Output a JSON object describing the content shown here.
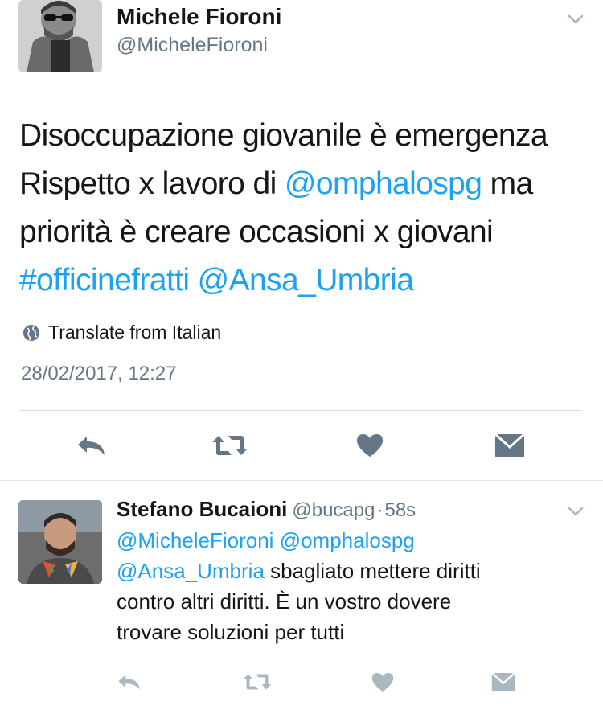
{
  "main_tweet": {
    "author": {
      "name": "Michele Fioroni",
      "handle": "@MicheleFioroni"
    },
    "text_lines": [
      [
        {
          "text": "Disoccupazione giovanile è emergenza",
          "type": "plain"
        }
      ],
      [
        {
          "text": "Rispetto x lavoro di ",
          "type": "plain"
        },
        {
          "text": "@omphalospg",
          "type": "mention"
        },
        {
          "text": " ma",
          "type": "plain"
        }
      ],
      [
        {
          "text": "priorità è creare occasioni x giovani",
          "type": "plain"
        }
      ],
      [
        {
          "text": "#officinefratti",
          "type": "hashtag"
        },
        {
          "text": " ",
          "type": "plain"
        },
        {
          "text": "@Ansa_Umbria",
          "type": "mention"
        }
      ]
    ],
    "translate_label": "Translate from Italian",
    "timestamp": "28/02/2017, 12:27",
    "actions": [
      {
        "name": "reply-button",
        "icon": "reply-icon"
      },
      {
        "name": "retweet-button",
        "icon": "retweet-icon"
      },
      {
        "name": "like-button",
        "icon": "heart-icon"
      },
      {
        "name": "direct-message-button",
        "icon": "envelope-icon"
      }
    ]
  },
  "reply_tweet": {
    "author": {
      "name": "Stefano Bucaioni",
      "handle": "@bucapg",
      "separator": "·",
      "time": "58s"
    },
    "text_lines": [
      [
        {
          "text": "@MicheleFioroni",
          "type": "mention"
        },
        {
          "text": " ",
          "type": "plain"
        },
        {
          "text": "@omphalospg",
          "type": "mention"
        }
      ],
      [
        {
          "text": "@Ansa_Umbria",
          "type": "mention"
        },
        {
          "text": " sbagliato mettere diritti",
          "type": "plain"
        }
      ],
      [
        {
          "text": "contro altri diritti. È un vostro dovere",
          "type": "plain"
        }
      ],
      [
        {
          "text": "trovare soluzioni per tutti",
          "type": "plain"
        }
      ]
    ],
    "actions": [
      {
        "name": "reply-button",
        "icon": "reply-icon"
      },
      {
        "name": "retweet-button",
        "icon": "retweet-icon"
      },
      {
        "name": "like-button",
        "icon": "heart-icon"
      },
      {
        "name": "direct-message-button",
        "icon": "envelope-icon"
      }
    ]
  },
  "colors": {
    "link": "#1da1f2",
    "text": "#14171a",
    "secondary": "#657786",
    "icon_main": "#657786",
    "icon_reply": "#aab8c2",
    "divider": "#e1e8ed"
  }
}
